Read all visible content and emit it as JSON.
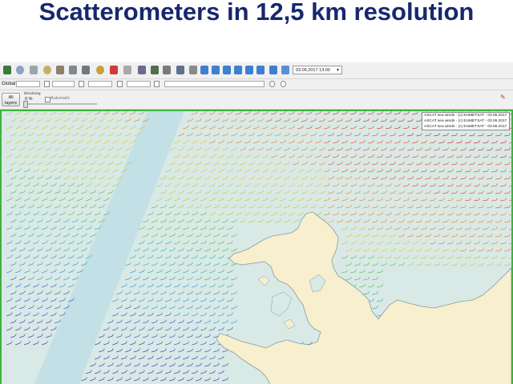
{
  "slide": {
    "title": "Scatterometers in 12,5 km resolution"
  },
  "toolbar": {
    "time_value": "03.06.2017 13:00",
    "icons": [
      "grid-icon",
      "globe-icon",
      "layers-icon",
      "star-icon",
      "cursor-icon",
      "move-icon",
      "zoom-icon",
      "reset-icon",
      "sun-icon",
      "settings-icon",
      "play-icon",
      "pause-icon",
      "step-icon",
      "step-back-icon",
      "forward-icon",
      "backward-icon",
      "calendar-icon"
    ]
  },
  "toolbar2": {
    "label": "Global"
  },
  "toolbar3": {
    "all_layers_label": "All layers",
    "dissolving_label": "Dissolving",
    "dissolving_value": "0 %",
    "automatic_label": "Automatic"
  },
  "map": {
    "legend": [
      "ASCAT sea winds - (c) EUMETSAT - 03.06.2017 13:00",
      "ASCAT sea winds - (c) EUMETSAT - 03.06.2017 13:00",
      "ASCAT sea winds - (c) EUMETSAT - 03.06.2017 13:00"
    ],
    "colors": {
      "sea": "#d8e9e6",
      "land": "#f7efcd",
      "coast": "#8a9aa0",
      "border": "#3fb23f",
      "swath_strip": "#c7e3e8"
    }
  }
}
